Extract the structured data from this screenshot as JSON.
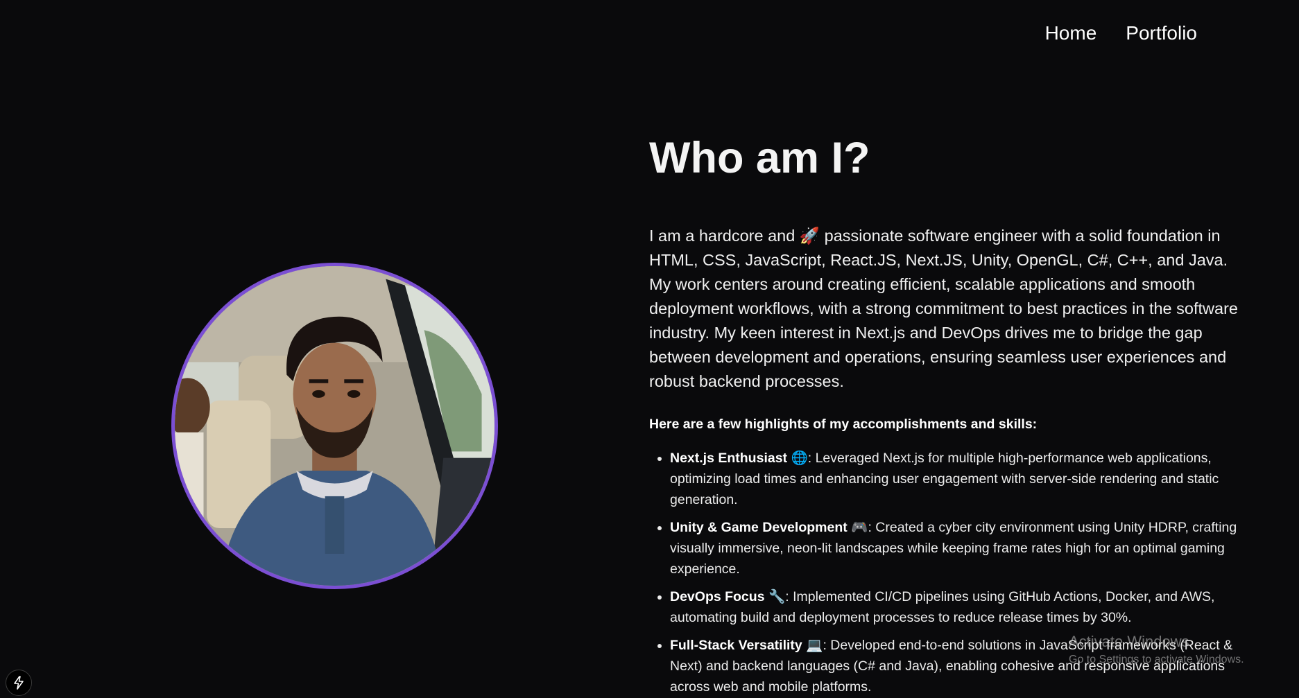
{
  "nav": {
    "items": [
      {
        "label": "Home"
      },
      {
        "label": "Portfolio"
      }
    ]
  },
  "avatar": {
    "icon": "profile-photo",
    "border_color": "#7b4fd3"
  },
  "main": {
    "heading": "Who am I?",
    "intro_before_emoji": "I am a hardcore and",
    "intro_emoji": "🚀",
    "intro_after_emoji": " passionate software engineer with a solid foundation in HTML, CSS, JavaScript, React.JS, Next.JS, Unity, OpenGL, C#, C++, and Java. My work centers around creating efficient, scalable applications and smooth deployment workflows, with a strong commitment to best practices in the software industry. My keen interest in Next.js and DevOps drives me to bridge the gap between development and operations, ensuring seamless user experiences and robust backend processes.",
    "highlights_title": "Here are a few highlights of my accomplishments and skills:",
    "highlights": [
      {
        "title": "Next.js Enthusiast",
        "emoji": "🌐",
        "text": ": Leveraged Next.js for multiple high-performance web applications, optimizing load times and enhancing user engagement with server-side rendering and static generation."
      },
      {
        "title": "Unity & Game Development",
        "emoji": "🎮",
        "text": ": Created a cyber city environment using Unity HDRP, crafting visually immersive, neon-lit landscapes while keeping frame rates high for an optimal gaming experience."
      },
      {
        "title": "DevOps Focus",
        "emoji": "🔧",
        "text": ": Implemented CI/CD pipelines using GitHub Actions, Docker, and AWS, automating build and deployment processes to reduce release times by 30%."
      },
      {
        "title": "Full-Stack Versatility",
        "emoji": "💻",
        "text": ": Developed end-to-end solutions in JavaScript frameworks (React & Next) and backend languages (C# and Java), enabling cohesive and responsive applications across web and mobile platforms."
      }
    ]
  },
  "watermark": {
    "line1": "Activate Windows",
    "line2": "Go to Settings to activate Windows."
  },
  "dev_indicator": {
    "icon": "lightning-icon"
  }
}
